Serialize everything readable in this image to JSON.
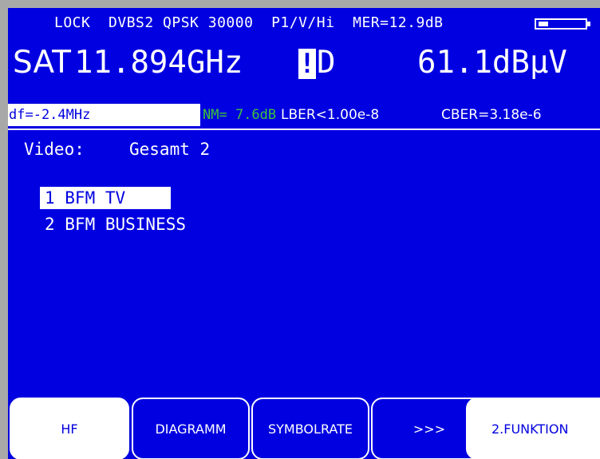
{
  "status_line": {
    "text": "LOCK  DVBS2 QPSK 30000  P1/V/Hi  MER=12.9dB"
  },
  "battery_icon": "battery-icon",
  "main_line": {
    "band": "SAT",
    "frequency": "11.894GHz",
    "lock_mark": "!",
    "polarization": "D",
    "level": "61.1dBμV"
  },
  "measurements": {
    "df": "df=-2.4MHz",
    "nm": "NM= 7.6dB",
    "lber": "LBER<1.00e-8",
    "cber": "CBER=3.18e-6"
  },
  "video": {
    "label": "Video:",
    "value": "Gesamt 2"
  },
  "programs": [
    {
      "label": "1 BFM TV"
    },
    {
      "label": "2 BFM BUSINESS"
    }
  ],
  "softkeys": {
    "hf": "HF",
    "diagramm": "DIAGRAMM",
    "symbolrate": "SYMBOLRATE",
    "more": ">>>",
    "funktion2": "2.FUNKTION"
  },
  "colors": {
    "screen_bg": "#0000e0",
    "text": "#ffffff",
    "nm_green": "#3cc33c",
    "bezel": "#a8a8a8"
  }
}
